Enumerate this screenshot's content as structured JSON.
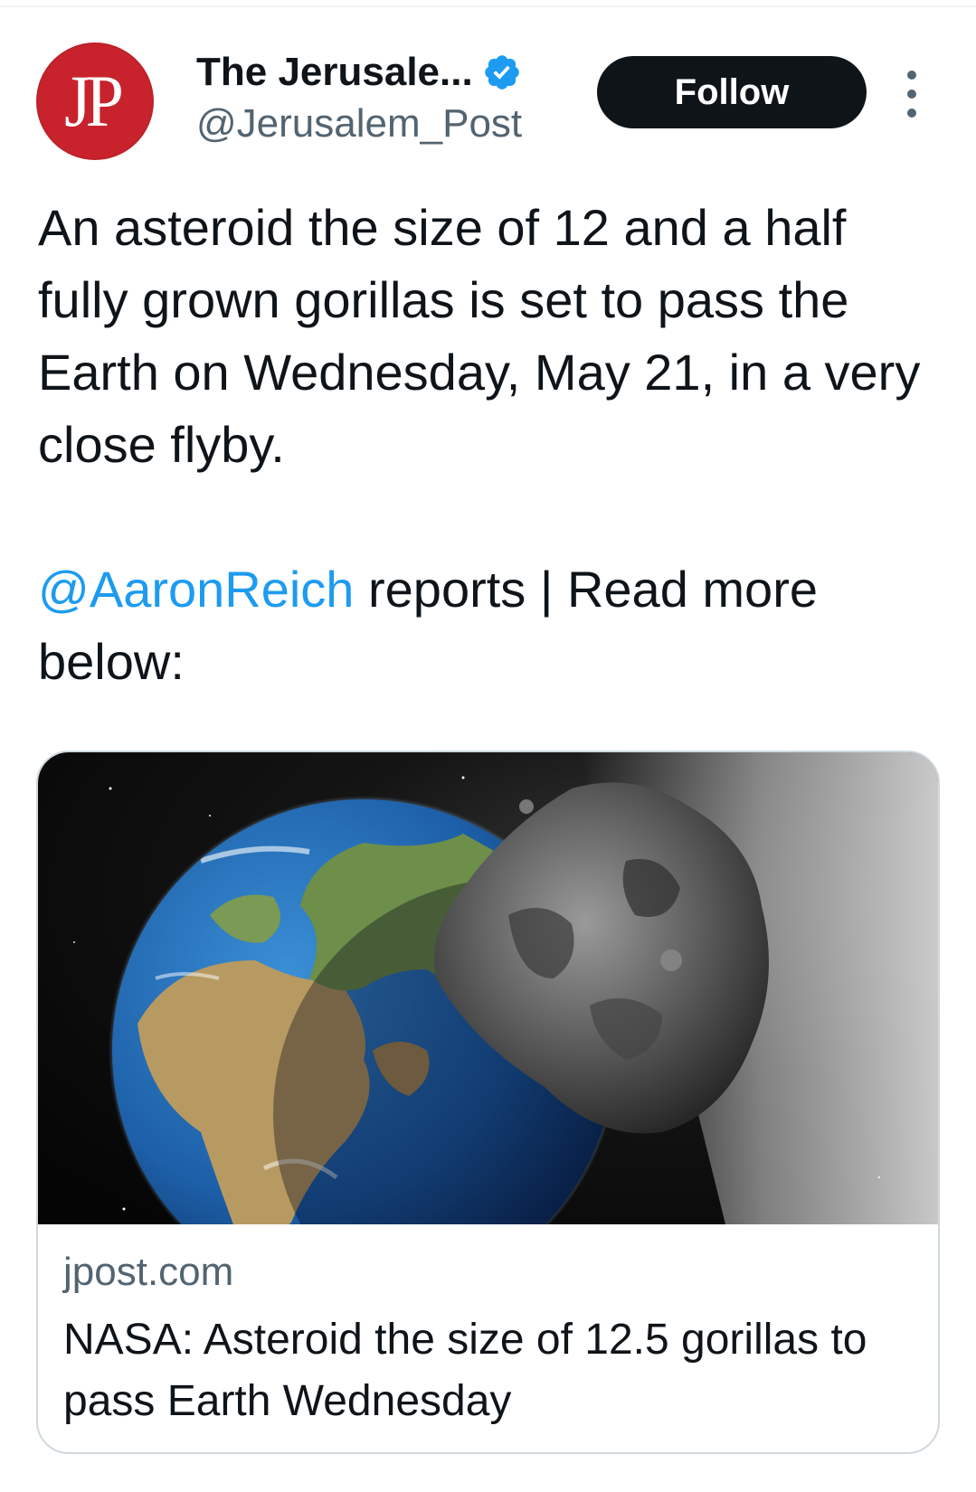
{
  "account": {
    "display_name": "The Jerusale...",
    "handle": "@Jerusalem_Post",
    "avatar_text": "JP",
    "verified": true,
    "verified_color": "#1d9bf0",
    "avatar_color": "#c8232c"
  },
  "actions": {
    "follow_label": "Follow",
    "more_icon": "more-vertical-icon"
  },
  "tweet": {
    "text_line1": "An asteroid the size of 12 and a half fully grown gorillas is set to pass the Earth on Wednesday, May 21, in a very close flyby.",
    "mention": "@AaronReich",
    "text_line2_rest": " reports | Read more below:"
  },
  "link_card": {
    "image": "earth-and-asteroid-image",
    "domain": "jpost.com",
    "title": "NASA: Asteroid the size of 12.5 gorillas to pass Earth Wednesday"
  }
}
